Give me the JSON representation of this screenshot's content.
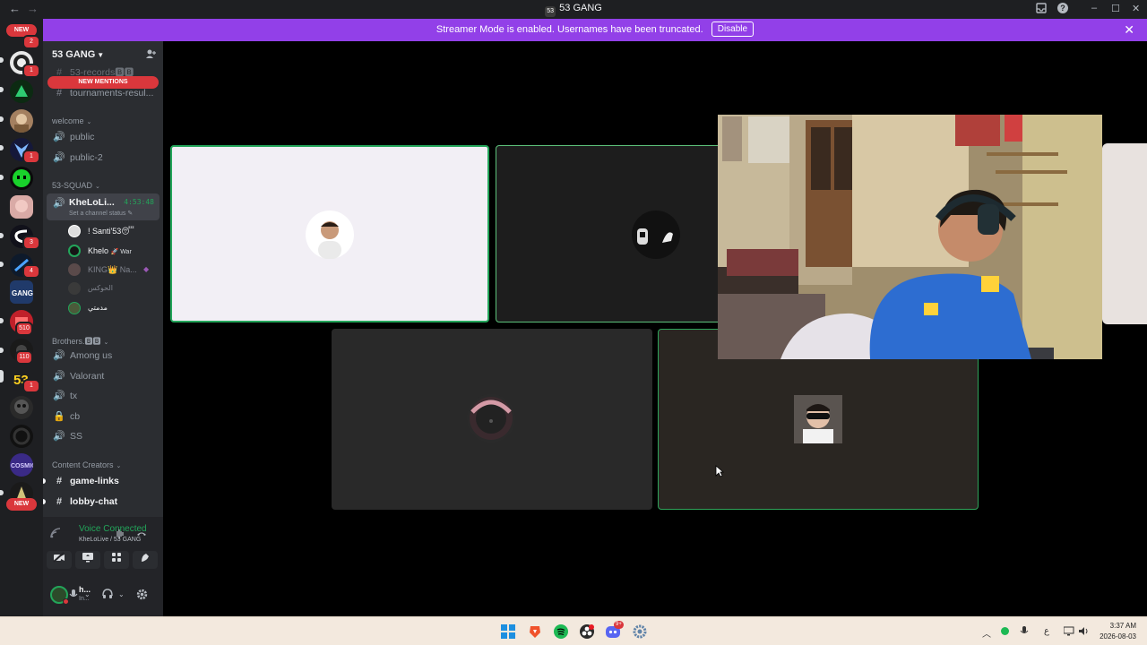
{
  "window": {
    "title": "53 GANG",
    "server_glyph": "53",
    "back_label": "←",
    "forward_label": "→",
    "inbox_icon": "inbox-icon",
    "help_label": "?",
    "minimize_label": "–",
    "maximize_label": "☐",
    "close_label": "✕"
  },
  "banner": {
    "text": "Streamer Mode is enabled. Usernames have been truncated.",
    "disable_label": "Disable",
    "close_label": "✕",
    "color": "#9240e8"
  },
  "rail": {
    "new_top": "NEW",
    "new_bottom": "NEW",
    "badges": [
      "2",
      "1",
      "1",
      "3",
      "4",
      "510",
      "110",
      "1",
      "1"
    ]
  },
  "sidebar": {
    "guild_name": "53 GANG",
    "new_mentions": "NEW MENTIONS",
    "channels_top": [
      {
        "icon": "#",
        "name": "53-records🅱🅱"
      },
      {
        "icon": "#",
        "name": "tournaments-resul..."
      }
    ],
    "categories": {
      "welcome": "welcome",
      "squad": "53-SQUAD",
      "brothers": "Brothers.🅱🅱",
      "creators": "Content Creators"
    },
    "welcome_channels": [
      {
        "icon": "🔊",
        "name": "public"
      },
      {
        "icon": "🔊",
        "name": "public-2"
      }
    ],
    "active_voice": {
      "name": "KheLoLi...",
      "timer": "4:53:48",
      "status_hint": "Set a channel status ✎"
    },
    "members": [
      {
        "name": "! Santi'53😴",
        "dim": false
      },
      {
        "name": "Khelo",
        "tag": "🚀 War",
        "dim": false
      },
      {
        "name": "KING👑 Na...",
        "dim": true
      },
      {
        "name": "الحوكس",
        "dim": true
      },
      {
        "name": "مدمتي",
        "dim": false
      }
    ],
    "brothers_channels": [
      {
        "icon": "🔊",
        "name": "Among us"
      },
      {
        "icon": "🔊",
        "name": "Valorant"
      },
      {
        "icon": "🔊",
        "name": "tx"
      },
      {
        "icon": "🔒",
        "name": "cb"
      },
      {
        "icon": "🔊",
        "name": "SS"
      }
    ],
    "creator_channels": [
      {
        "icon": "#",
        "name": "game-links"
      },
      {
        "icon": "#",
        "name": "lobby-chat"
      }
    ]
  },
  "voice_panel": {
    "status": "Voice Connected",
    "location": "KheLoLive / 53 GANG",
    "user_name": "h...",
    "user_status": "In..."
  },
  "taskbar": {
    "time": "3:37 AM",
    "date": "2026-08-03",
    "lang": "ع",
    "discord_badge": "9+"
  }
}
